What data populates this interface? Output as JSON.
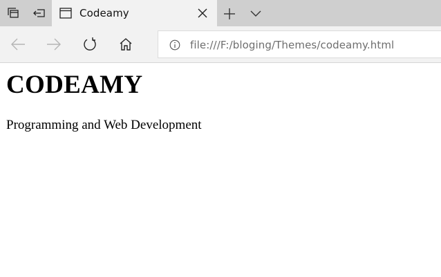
{
  "browser": {
    "tab": {
      "title": "Codeamy"
    },
    "address_bar": {
      "url": "file:///F:/bloging/Themes/codeamy.html"
    },
    "icons": {
      "tab_manager": "tabs-aside-icon",
      "set_aside": "set-aside-tabs-icon",
      "page": "page-icon",
      "close": "close-icon",
      "new_tab": "plus-icon",
      "tab_list": "chevron-down-icon",
      "back": "back-arrow-icon",
      "forward": "forward-arrow-icon",
      "refresh": "refresh-icon",
      "home": "home-icon",
      "info": "info-icon"
    },
    "colors": {
      "tabstrip": "#cfcfcf",
      "toolbar": "#f2f2f2",
      "disabled": "#b5b5b5",
      "url_text": "#6e6e6e"
    }
  },
  "page": {
    "heading": "CODEAMY",
    "paragraph": "Programming and Web Development"
  }
}
